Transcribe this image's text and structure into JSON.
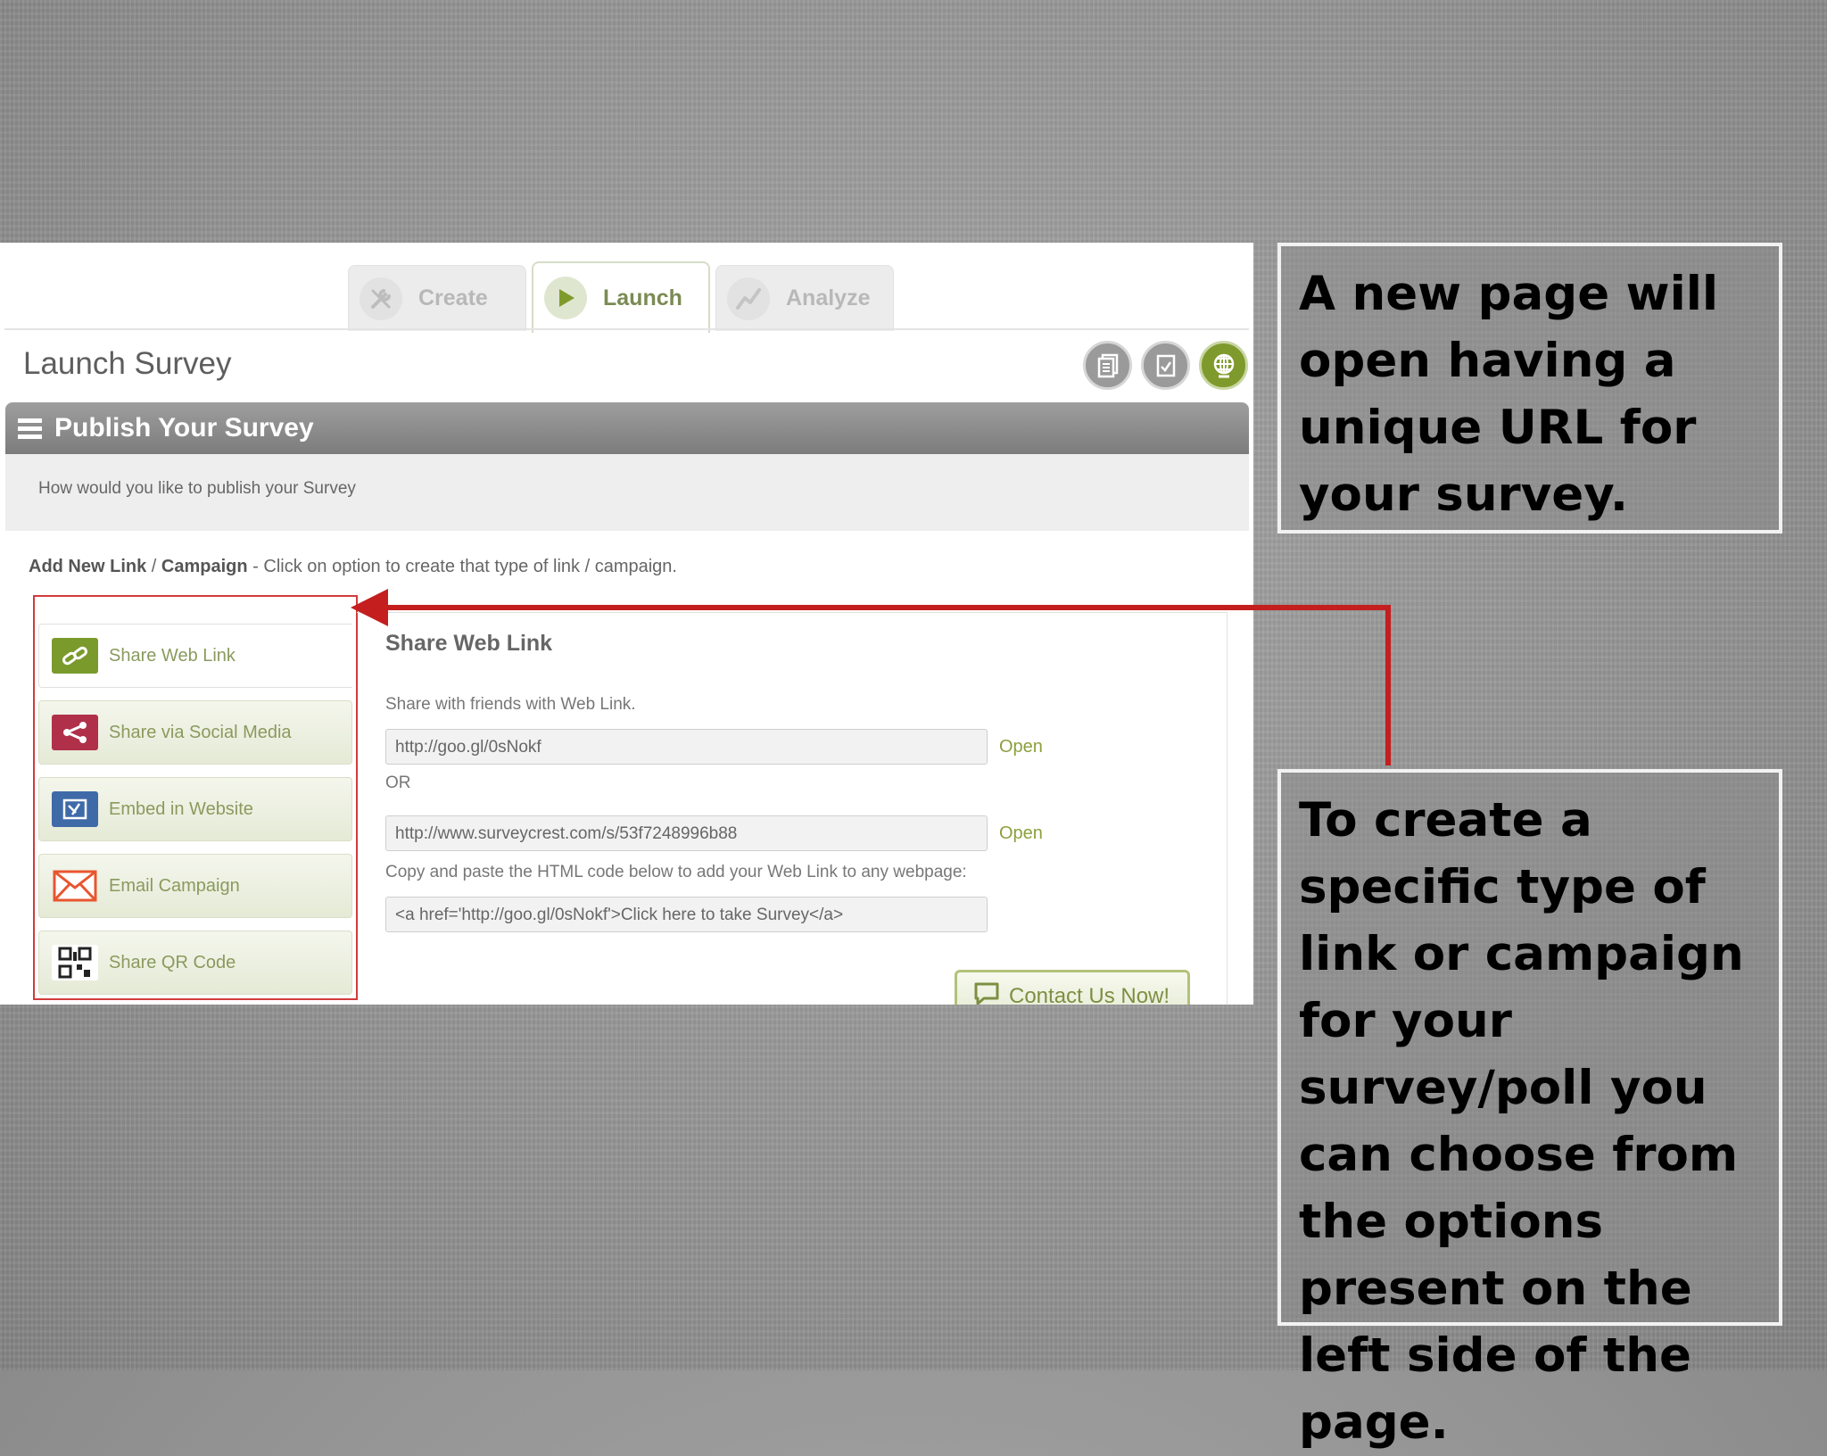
{
  "app": {
    "tabs": [
      {
        "label": "Create",
        "icon": "tools-icon"
      },
      {
        "label": "Launch",
        "icon": "play-icon"
      },
      {
        "label": "Analyze",
        "icon": "chart-line-icon"
      }
    ],
    "page_title": "Launch Survey",
    "top_icons": [
      "copy-icon",
      "checklist-icon",
      "globe-icon"
    ]
  },
  "publish": {
    "title": "Publish Your Survey",
    "subtitle": "How would you like to publish your Survey"
  },
  "add_link": {
    "bold_a": "Add New Link",
    "sep": "/",
    "bold_b": "Campaign",
    "rest": "- Click on option to create that type of link / campaign."
  },
  "menu": [
    {
      "label": "Share Web Link",
      "icon": "link-icon",
      "color": "#7a9a2c"
    },
    {
      "label": "Share via Social Media",
      "icon": "share-icon",
      "color": "#b0304a"
    },
    {
      "label": "Embed in Website",
      "icon": "embed-icon",
      "color": "#3f6aa8"
    },
    {
      "label": "Email Campaign",
      "icon": "envelope-icon",
      "color": "#e8552f"
    },
    {
      "label": "Share QR Code",
      "icon": "qr-code-icon",
      "color": "#222222"
    }
  ],
  "panel": {
    "title": "Share Web Link",
    "share_text": "Share with friends with Web Link.",
    "short_url": "http://goo.gl/0sNokf",
    "open_label": "Open",
    "or_label": "OR",
    "long_url": "http://www.surveycrest.com/s/53f7248996b88",
    "embed_text": "Copy and paste the HTML code below to add your Web Link to any webpage:",
    "embed_code": "<a href='http://goo.gl/0sNokf'>Click here to take  Survey</a>",
    "contact_label": "Contact Us Now!"
  },
  "callouts": {
    "top": "A  new page will open having a unique URL for your survey.",
    "bottom": "To create a specific type of link or campaign for your survey/poll you can choose from the options present on the left side of the page."
  },
  "colors": {
    "accent_green": "#7f9a2c",
    "arrow_red": "#c41e1e"
  }
}
